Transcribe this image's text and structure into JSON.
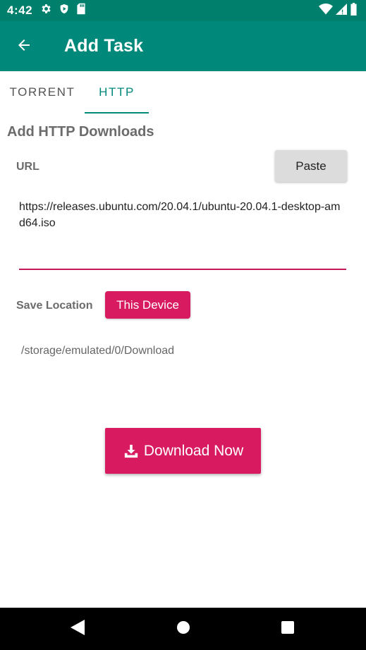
{
  "status_bar": {
    "time": "4:42",
    "icons_left": [
      "gear-icon",
      "shield-icon",
      "sd-card-icon"
    ],
    "icons_right": [
      "wifi-icon",
      "signal-icon",
      "battery-icon"
    ]
  },
  "app_bar": {
    "title": "Add Task",
    "back_icon": "arrow-back-icon"
  },
  "tabs": [
    {
      "label": "TORRENT",
      "selected": false
    },
    {
      "label": "HTTP",
      "selected": true
    }
  ],
  "main": {
    "section_title": "Add HTTP Downloads",
    "url_label": "URL",
    "paste_label": "Paste",
    "url_value": "https://releases.ubuntu.com/20.04.1/ubuntu-20.04.1-desktop-amd64.iso",
    "save_location_label": "Save Location",
    "device_label": "This Device",
    "path": "/storage/emulated/0/Download",
    "download_label": "Download Now",
    "download_icon": "download-icon"
  },
  "nav_bar": {
    "icons": [
      "nav-back-icon",
      "nav-home-icon",
      "nav-recents-icon"
    ]
  },
  "colors": {
    "primary": "#00897b",
    "primary_dark": "#00806c",
    "accent": "#d81b60",
    "underline": "#c2185b"
  }
}
